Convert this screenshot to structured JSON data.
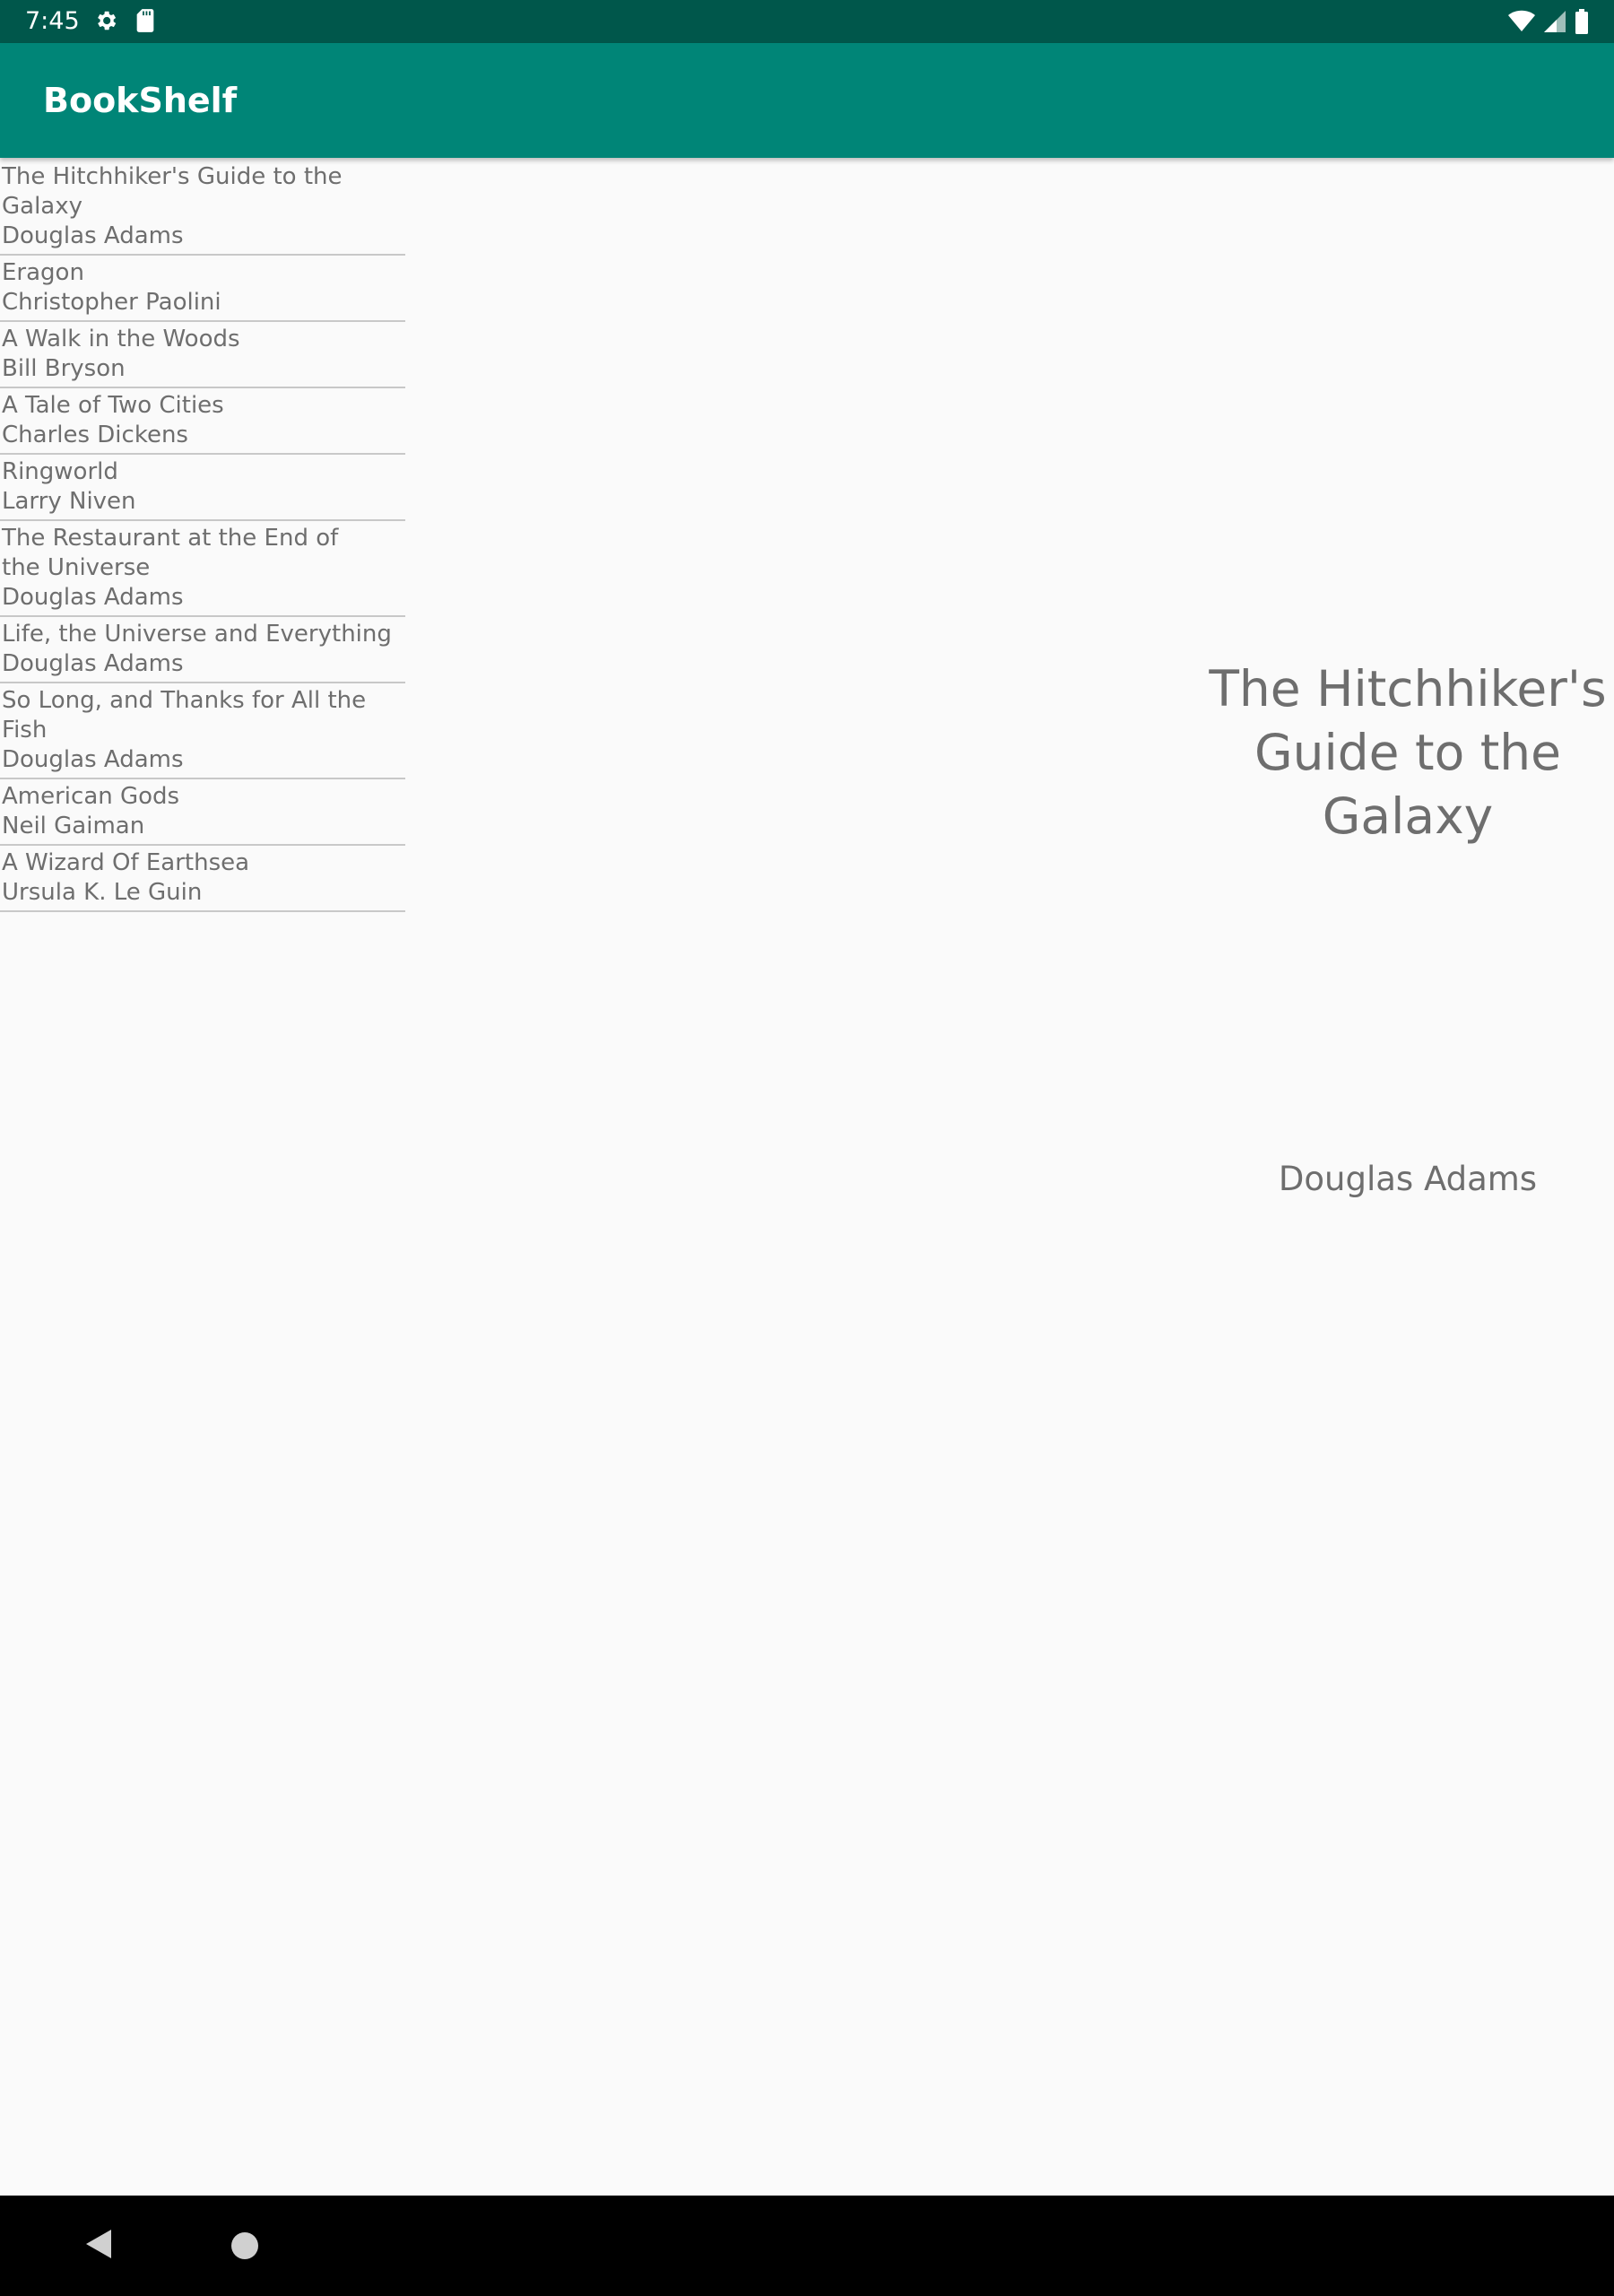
{
  "status_bar": {
    "time": "7:45",
    "left_icons": [
      "settings-icon",
      "sd-card-icon"
    ],
    "right_icons": [
      "wifi-icon",
      "cellular-signal-icon",
      "battery-icon"
    ]
  },
  "app_bar": {
    "title": "BookShelf"
  },
  "books": [
    {
      "title": "The Hitchhiker's Guide to the Galaxy",
      "author": "Douglas Adams"
    },
    {
      "title": "Eragon",
      "author": "Christopher Paolini"
    },
    {
      "title": "A Walk in the Woods",
      "author": "Bill Bryson"
    },
    {
      "title": "A Tale of Two Cities",
      "author": "Charles Dickens"
    },
    {
      "title": "Ringworld",
      "author": "Larry Niven"
    },
    {
      "title": "The Restaurant at the End of the Universe",
      "author": "Douglas Adams"
    },
    {
      "title": "Life, the Universe and Everything",
      "author": "Douglas Adams"
    },
    {
      "title": "So Long, and Thanks for All the Fish",
      "author": "Douglas Adams"
    },
    {
      "title": "American Gods",
      "author": "Neil Gaiman"
    },
    {
      "title": "A Wizard Of Earthsea",
      "author": "Ursula K. Le Guin"
    }
  ],
  "detail": {
    "title": "The Hitchhiker's Guide to the Galaxy",
    "author": "Douglas Adams"
  },
  "nav_bar": {
    "icons": [
      "back-icon",
      "home-icon"
    ]
  },
  "colors": {
    "status_bar": "#00574B",
    "app_bar": "#008577",
    "background": "#FAFAFA",
    "text": "#6E6E6E",
    "divider": "#C8C8C8"
  }
}
